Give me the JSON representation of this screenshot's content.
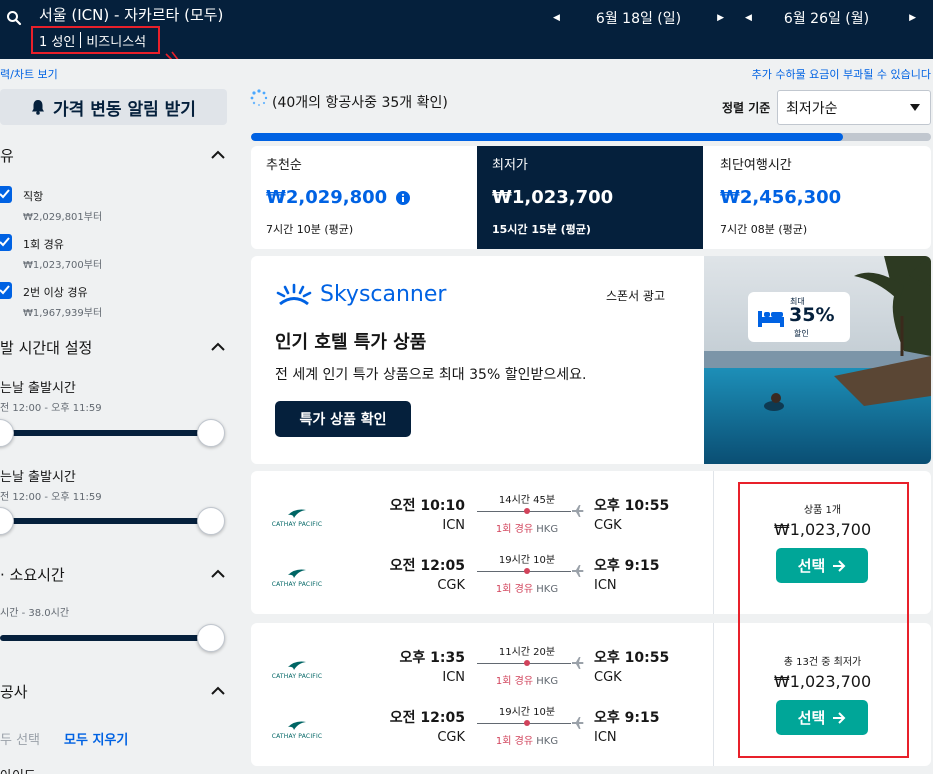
{
  "header": {
    "route": "서울 (ICN) - 자카르타 (모두)",
    "passengers": "1 성인",
    "cabin": "비즈니스석",
    "depart_date": "6월 18일 (일)",
    "return_date": "6월 26일 (월)"
  },
  "sidebar": {
    "chart_link": "력/차트 보기",
    "price_alert": "가격 변동 알림 받기",
    "stops_title": "유",
    "stops": [
      {
        "label": "직항",
        "price": "₩2,029,801부터"
      },
      {
        "label": "1회 경유",
        "price": "₩1,023,700부터"
      },
      {
        "label": "2번 이상 경유",
        "price": "₩1,967,939부터"
      }
    ],
    "time_title": "발 시간대 설정",
    "outbound_title": "는날 출발시간",
    "outbound_range": "전 12:00 - 오후 11:59",
    "return_title": "는날 출발시간",
    "return_range": "전 12:00 - 오후 11:59",
    "duration_title": "· 소요시간",
    "duration_range": "시간 - 38.0시간",
    "airlines_title": "공사",
    "select_all": "두 선택",
    "clear_all": "모두 지우기",
    "bottom_partial": "아이드"
  },
  "main": {
    "fee_note": "추가 수하물 요금이 부과될 수 있습니다",
    "loading": "(40개의 항공사중 35개 확인)",
    "sort_label": "정렬 기준",
    "sort_value": "최저가순",
    "progress": 0.87,
    "tabs": [
      {
        "name": "추천순",
        "price": "₩2,029,800",
        "duration": "7시간 10분 (평균)"
      },
      {
        "name": "최저가",
        "price": "₩1,023,700",
        "duration": "15시간 15분 (평균)"
      },
      {
        "name": "최단여행시간",
        "price": "₩2,456,300",
        "duration": "7시간 08분 (평균)"
      }
    ],
    "ad": {
      "brand": "Skyscanner",
      "sponsor": "스폰서 광고",
      "title": "인기 호텔 특가 상품",
      "desc": "전 세계 인기 특가 상품으로 최대 35% 할인받으세요.",
      "button": "특가 상품 확인",
      "badge_top": "최대",
      "badge_pct": "35%",
      "badge_bottom": "할인"
    },
    "results": [
      {
        "legs": [
          {
            "airline": "CATHAY PACIFIC",
            "dep_time": "오전 10:10",
            "dep_code": "ICN",
            "duration": "14시간 45분",
            "stops": "1회 경유",
            "via": "HKG",
            "arr_time": "오후 10:55",
            "arr_code": "CGK"
          },
          {
            "airline": "CATHAY PACIFIC",
            "dep_time": "오전 12:05",
            "dep_code": "CGK",
            "duration": "19시간 10분",
            "stops": "1회 경유",
            "via": "HKG",
            "arr_time": "오후 9:15",
            "arr_code": "ICN"
          }
        ],
        "note": "상품 1개",
        "price": "₩1,023,700",
        "select": "선택"
      },
      {
        "legs": [
          {
            "airline": "CATHAY PACIFIC",
            "dep_time": "오후 1:35",
            "dep_code": "ICN",
            "duration": "11시간 20분",
            "stops": "1회 경유",
            "via": "HKG",
            "arr_time": "오후 10:55",
            "arr_code": "CGK"
          },
          {
            "airline": "CATHAY PACIFIC",
            "dep_time": "오전 12:05",
            "dep_code": "CGK",
            "duration": "19시간 10분",
            "stops": "1회 경유",
            "via": "HKG",
            "arr_time": "오후 9:15",
            "arr_code": "ICN"
          }
        ],
        "note": "총 13건 중 최저가",
        "price": "₩1,023,700",
        "select": "선택"
      }
    ]
  },
  "colors": {
    "header_bg": "#05203c",
    "accent_blue": "#0062e3",
    "select_green": "#00a698",
    "stop_red": "#d1435b",
    "annotation_red": "#e8202a"
  }
}
